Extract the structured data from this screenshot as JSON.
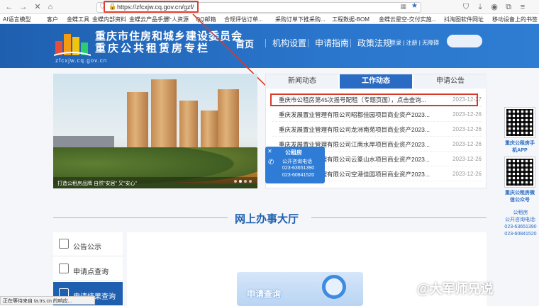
{
  "browser": {
    "url": "https://zfcxjw.cq.gov.cn/gzf/",
    "bookmarks": [
      "AI语言模型",
      "客户",
      "金蝶工具",
      "金蝶内部资料",
      "金蝶云产品手册",
      "个人资源",
      "QQ邮箱",
      "合规评估订单...",
      "采购订单下推采购...",
      "工程数据-BOM",
      "金蝶云星空-交付实施...",
      "抖淘图软件网址",
      "移动设备上的书签"
    ]
  },
  "header": {
    "title": "重庆市住房和城乡建设委员会",
    "subtitle": "重庆公共租赁房专栏",
    "domain": "zfcxjw.cq.gov.cn",
    "nav": [
      "首页",
      "机构设置",
      "申请指南",
      "政策法规"
    ],
    "login": "登录 | 注册 | 无障碍"
  },
  "banner": {
    "caption": "打造公租房品牌 自然\"安居\" 又\"安心\""
  },
  "news": {
    "tabs": [
      "新闻动态",
      "工作动态",
      "申请公告"
    ],
    "active_tab": "工作动态",
    "items": [
      {
        "title": "重庆市公租房第45次摇号配租（专题页面），点击查询...",
        "date": "2023-12-27"
      },
      {
        "title": "重庆发展置业管理有限公司昭都佳园项目商业资产2023...",
        "date": "2023-12-26"
      },
      {
        "title": "重庆发展置业管理有限公司龙洲南苑项目商业资产2023...",
        "date": "2023-12-26"
      },
      {
        "title": "重庆发展置业管理有限公司江南水岸项目商业资产2023...",
        "date": "2023-12-26"
      },
      {
        "title": "重庆发展置业管理有限公司云篆山水项目商业资产2023...",
        "date": "2023-12-26"
      },
      {
        "title": "重庆发展置业管理有限公司空港佳园项目商业资产2023...",
        "date": "2023-12-26"
      }
    ]
  },
  "popup": {
    "title": "公租房",
    "label": "公开咨询电话",
    "phone1": "023-63651390",
    "phone2": "023-60841520"
  },
  "qr": {
    "app_label": "重庆公租房手机APP",
    "wechat_label": "重庆公租房微信公众号"
  },
  "right_info": {
    "org": "公租房",
    "hotline_label": "公开咨询电话:",
    "phone1": "023-63651390",
    "phone2": "023-60841520"
  },
  "services": {
    "title": "网上办事大厅",
    "side_items": [
      "公告公示",
      "申请点查询",
      "申请结果查询"
    ],
    "card_label": "申请查询"
  },
  "status_bar": "正在等待来自 ta.trs.cn 的响应...",
  "watermark": "@大军师兄说",
  "colors": {
    "brand": "#1f5fb0",
    "highlight": "#d83a2a"
  }
}
